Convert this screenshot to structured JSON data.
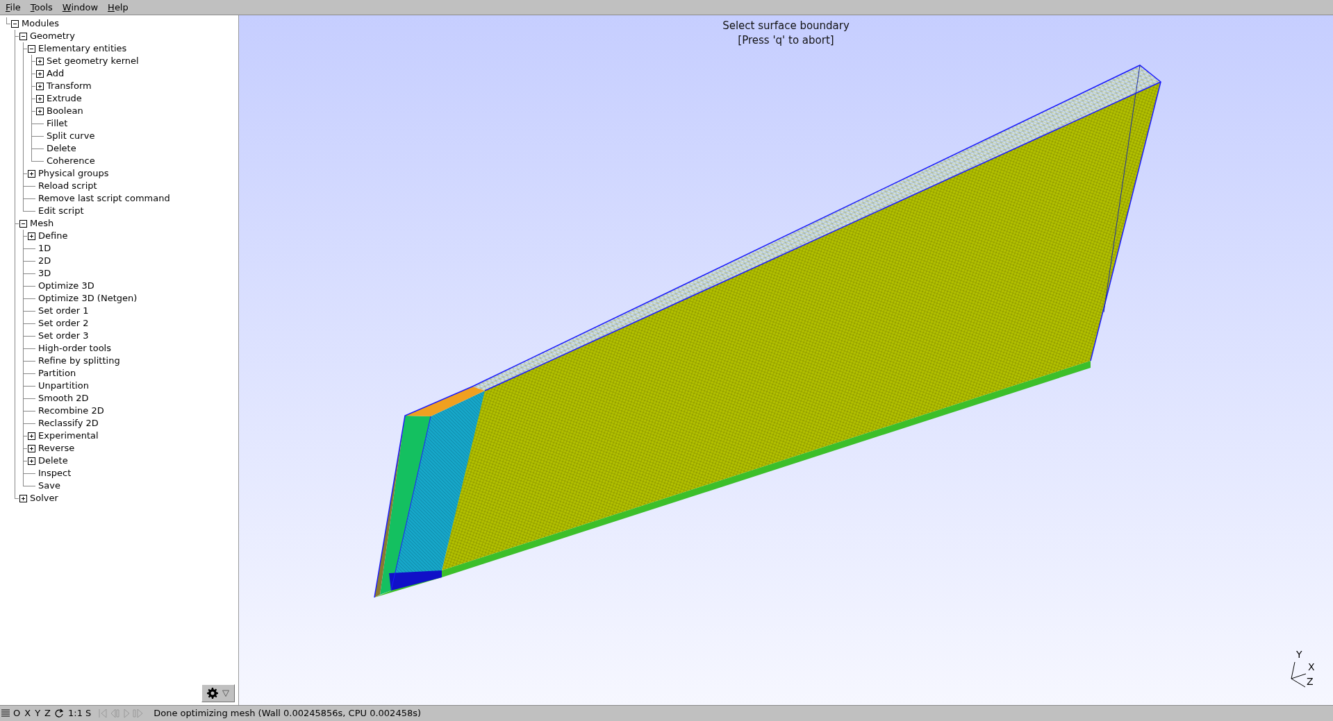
{
  "menu": [
    {
      "label": "File"
    },
    {
      "label": "Tools"
    },
    {
      "label": "Window"
    },
    {
      "label": "Help"
    }
  ],
  "tree": [
    {
      "label": "Modules",
      "kind": "folder",
      "expanded": true,
      "children": [
        {
          "label": "Geometry",
          "kind": "folder",
          "expanded": true,
          "children": [
            {
              "label": "Elementary entities",
              "kind": "folder",
              "expanded": true,
              "children": [
                {
                  "label": "Set geometry kernel",
                  "kind": "folder",
                  "expanded": false
                },
                {
                  "label": "Add",
                  "kind": "folder",
                  "expanded": false
                },
                {
                  "label": "Transform",
                  "kind": "folder",
                  "expanded": false
                },
                {
                  "label": "Extrude",
                  "kind": "folder",
                  "expanded": false
                },
                {
                  "label": "Boolean",
                  "kind": "folder",
                  "expanded": false
                },
                {
                  "label": "Fillet",
                  "kind": "leaf"
                },
                {
                  "label": "Split curve",
                  "kind": "leaf"
                },
                {
                  "label": "Delete",
                  "kind": "leaf"
                },
                {
                  "label": "Coherence",
                  "kind": "leaf"
                }
              ]
            },
            {
              "label": "Physical groups",
              "kind": "folder",
              "expanded": false
            },
            {
              "label": "Reload script",
              "kind": "leaf"
            },
            {
              "label": "Remove last script command",
              "kind": "leaf"
            },
            {
              "label": "Edit script",
              "kind": "leaf"
            }
          ]
        },
        {
          "label": "Mesh",
          "kind": "folder",
          "expanded": true,
          "children": [
            {
              "label": "Define",
              "kind": "folder",
              "expanded": false
            },
            {
              "label": "1D",
              "kind": "leaf"
            },
            {
              "label": "2D",
              "kind": "leaf"
            },
            {
              "label": "3D",
              "kind": "leaf"
            },
            {
              "label": "Optimize 3D",
              "kind": "leaf"
            },
            {
              "label": "Optimize 3D (Netgen)",
              "kind": "leaf"
            },
            {
              "label": "Set order 1",
              "kind": "leaf"
            },
            {
              "label": "Set order 2",
              "kind": "leaf"
            },
            {
              "label": "Set order 3",
              "kind": "leaf"
            },
            {
              "label": "High-order tools",
              "kind": "leaf"
            },
            {
              "label": "Refine by splitting",
              "kind": "leaf"
            },
            {
              "label": "Partition",
              "kind": "leaf"
            },
            {
              "label": "Unpartition",
              "kind": "leaf"
            },
            {
              "label": "Smooth 2D",
              "kind": "leaf"
            },
            {
              "label": "Recombine 2D",
              "kind": "leaf"
            },
            {
              "label": "Reclassify 2D",
              "kind": "leaf"
            },
            {
              "label": "Experimental",
              "kind": "folder",
              "expanded": false
            },
            {
              "label": "Reverse",
              "kind": "folder",
              "expanded": false
            },
            {
              "label": "Delete",
              "kind": "folder",
              "expanded": false
            },
            {
              "label": "Inspect",
              "kind": "leaf"
            },
            {
              "label": "Save",
              "kind": "leaf"
            }
          ]
        },
        {
          "label": "Solver",
          "kind": "folder",
          "expanded": false
        }
      ]
    }
  ],
  "viewport": {
    "message": [
      "Select surface boundary",
      "[Press 'q' to abort]"
    ],
    "axes": [
      "Y",
      "X",
      "Z"
    ]
  },
  "status_bar": {
    "view_buttons": [
      "O",
      "X",
      "Y",
      "Z"
    ],
    "scale_button": "1:1",
    "snap_button": "S",
    "message": "Done optimizing mesh (Wall 0.00245856s, CPU 0.002458s)"
  }
}
